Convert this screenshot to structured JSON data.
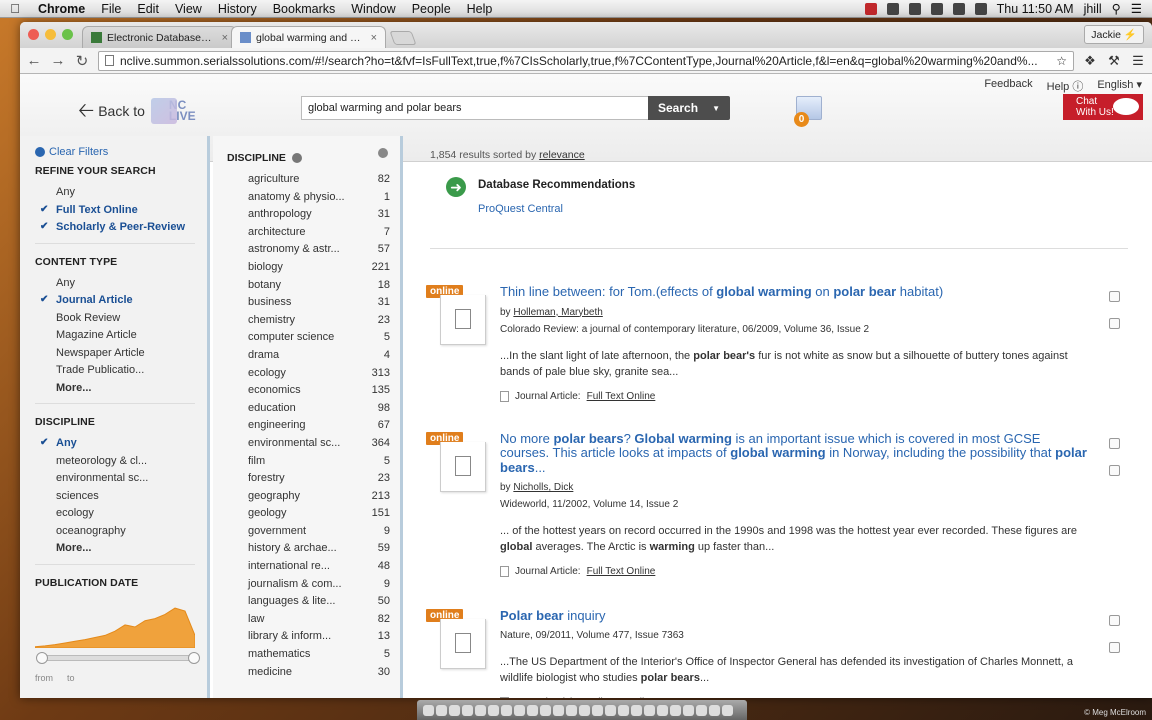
{
  "menubar": {
    "app": "Chrome",
    "items": [
      "File",
      "Edit",
      "View",
      "History",
      "Bookmarks",
      "Window",
      "People",
      "Help"
    ],
    "clock": "Thu 11:50 AM",
    "user": "jhill"
  },
  "tabs": [
    {
      "title": "Electronic Databases | Uni"
    },
    {
      "title": "global warming and polar"
    }
  ],
  "profile": "Jackie",
  "url": "nclive.summon.serialssolutions.com/#!/search?ho=t&fvf=IsFullText,true,f%7CIsScholarly,true,f%7CContentType,Journal%20Article,f&l=en&q=global%20warming%20and%...",
  "header": {
    "feedback": "Feedback",
    "help": "Help",
    "language": "English",
    "back_label": "Back to",
    "logo_top": "NC",
    "logo_bottom": "LIVE",
    "search_value": "global warming and polar bears",
    "search_button": "Search",
    "folder_count": "0",
    "chat_line1": "Chat",
    "chat_line2": "With Us!"
  },
  "left": {
    "clear_filters": "Clear Filters",
    "refine_header": "REFINE YOUR SEARCH",
    "refine_items": [
      "Any",
      "Full Text Online",
      "Scholarly & Peer-Review"
    ],
    "content_header": "CONTENT TYPE",
    "content_items": [
      "Any",
      "Journal Article",
      "Book Review",
      "Magazine Article",
      "Newspaper Article",
      "Trade Publicatio..."
    ],
    "more": "More...",
    "discipline_header": "DISCIPLINE",
    "discipline_items": [
      "Any",
      "meteorology & cl...",
      "environmental sc...",
      "sciences",
      "ecology",
      "oceanography"
    ],
    "pubdate_header": "PUBLICATION DATE",
    "pub_histogram": [
      0.03,
      0.05,
      0.08,
      0.12,
      0.16,
      0.2,
      0.25,
      0.3,
      0.4,
      0.55,
      0.5,
      0.65,
      0.7,
      0.8,
      0.95,
      0.88,
      0.3
    ],
    "from": "from",
    "to": "to"
  },
  "discipline": {
    "header": "DISCIPLINE",
    "rows": [
      {
        "name": "agriculture",
        "count": "82"
      },
      {
        "name": "anatomy & physio...",
        "count": "1"
      },
      {
        "name": "anthropology",
        "count": "31"
      },
      {
        "name": "architecture",
        "count": "7"
      },
      {
        "name": "astronomy & astr...",
        "count": "57"
      },
      {
        "name": "biology",
        "count": "221"
      },
      {
        "name": "botany",
        "count": "18"
      },
      {
        "name": "business",
        "count": "31"
      },
      {
        "name": "chemistry",
        "count": "23"
      },
      {
        "name": "computer science",
        "count": "5"
      },
      {
        "name": "drama",
        "count": "4"
      },
      {
        "name": "ecology",
        "count": "313"
      },
      {
        "name": "economics",
        "count": "135"
      },
      {
        "name": "education",
        "count": "98"
      },
      {
        "name": "engineering",
        "count": "67"
      },
      {
        "name": "environmental sc...",
        "count": "364"
      },
      {
        "name": "film",
        "count": "5"
      },
      {
        "name": "forestry",
        "count": "23"
      },
      {
        "name": "geography",
        "count": "213"
      },
      {
        "name": "geology",
        "count": "151"
      },
      {
        "name": "government",
        "count": "9"
      },
      {
        "name": "history & archae...",
        "count": "59"
      },
      {
        "name": "international re...",
        "count": "48"
      },
      {
        "name": "journalism & com...",
        "count": "9"
      },
      {
        "name": "languages & lite...",
        "count": "50"
      },
      {
        "name": "law",
        "count": "82"
      },
      {
        "name": "library & inform...",
        "count": "13"
      },
      {
        "name": "mathematics",
        "count": "5"
      },
      {
        "name": "medicine",
        "count": "30"
      }
    ]
  },
  "results": {
    "count_text": "1,854 results sorted by",
    "sort": "relevance",
    "dbrec_title": "Database Recommendations",
    "dbrec_link": "ProQuest Central",
    "badge": "online",
    "type_label": "Journal Article:",
    "full_text": "Full Text Online",
    "items": [
      {
        "title_html": "Thin line between: for Tom.(effects of <b>global warming</b> on <b>polar bear</b> habitat)",
        "by": "by",
        "author": "Holleman, Marybeth",
        "source": "Colorado Review: a journal of contemporary literature, 06/2009, Volume 36, Issue 2",
        "snippet_html": "...In the slant light of late afternoon, the <b>polar bear's</b> fur is not white as snow but a silhouette of buttery tones against bands of pale blue sky, granite sea..."
      },
      {
        "title_html": "No more <b>polar bears</b>? <b>Global warming</b> is an important issue which is covered in most GCSE courses. This article looks at impacts of <b>global warming</b> in Norway, including the possibility that <b>polar bears</b>...",
        "by": "by",
        "author": "Nicholls, Dick",
        "source": "Wideworld, 11/2002, Volume 14, Issue 2",
        "snippet_html": "... of the hottest years on record occurred in the 1990s and 1998 was the hottest year ever recorded. These figures are <b>global</b> averages. The Arctic is <b>warming</b> up faster than..."
      },
      {
        "title_html": "<b>Polar bear</b> inquiry",
        "by": "",
        "author": "",
        "source": "Nature, 09/2011, Volume 477, Issue 7363",
        "snippet_html": "...The US Department of the Interior's Office of Inspector General has defended its investigation of Charles Monnett, a wildlife biologist who studies <b>polar bears</b>..."
      }
    ]
  },
  "credit": "© Meg McElroom",
  "colors": {
    "accent": "#2a66b0",
    "badge": "#e07e1c",
    "chat": "#c61e2a"
  }
}
